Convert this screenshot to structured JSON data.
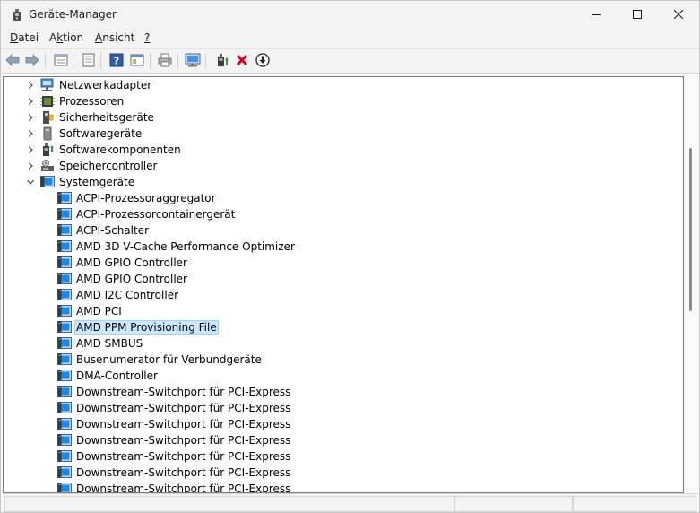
{
  "window": {
    "title": "Geräte-Manager",
    "app_icon": "device-manager-icon",
    "controls": [
      "minimize-icon",
      "maximize-icon",
      "close-icon"
    ]
  },
  "menu": [
    {
      "label": "Datei",
      "underline_index": 0
    },
    {
      "label": "Aktion",
      "underline_index": 1
    },
    {
      "label": "Ansicht",
      "underline_index": 0
    },
    {
      "label": "?",
      "underline_index": 0
    }
  ],
  "toolbar": [
    "back-arrow-icon",
    "forward-arrow-icon",
    "properties-list-icon",
    "properties-page-icon",
    "help-icon",
    "view-details-icon",
    "print-icon",
    "monitor-scan-icon",
    "update-driver-icon",
    "uninstall-device-icon",
    "disable-device-icon"
  ],
  "tree": {
    "categories": [
      {
        "label": "Netzwerkadapter",
        "icon": "network-adapter-icon",
        "expanded": false
      },
      {
        "label": "Prozessoren",
        "icon": "processor-icon",
        "expanded": false
      },
      {
        "label": "Sicherheitsgeräte",
        "icon": "security-device-icon",
        "expanded": false
      },
      {
        "label": "Softwaregeräte",
        "icon": "software-device-icon",
        "expanded": false
      },
      {
        "label": "Softwarekomponenten",
        "icon": "software-component-icon",
        "expanded": false
      },
      {
        "label": "Speichercontroller",
        "icon": "storage-controller-icon",
        "expanded": false
      },
      {
        "label": "Systemgeräte",
        "icon": "system-device-icon",
        "expanded": true
      }
    ],
    "system_devices": [
      "ACPI-Prozessoraggregator",
      "ACPI-Prozessorcontainergerät",
      "ACPI-Schalter",
      "AMD 3D V-Cache Performance Optimizer",
      "AMD GPIO Controller",
      "AMD GPIO Controller",
      "AMD I2C Controller",
      "AMD PCI",
      "AMD PPM Provisioning File",
      "AMD SMBUS",
      "Busenumerator für Verbundgeräte",
      "DMA-Controller",
      "Downstream-Switchport für PCI-Express",
      "Downstream-Switchport für PCI-Express",
      "Downstream-Switchport für PCI-Express",
      "Downstream-Switchport für PCI-Express",
      "Downstream-Switchport für PCI-Express",
      "Downstream-Switchport für PCI-Express",
      "Downstream-Switchport für PCI-Express"
    ],
    "selected_device": "AMD PPM Provisioning File"
  },
  "colors": {
    "selection_bg": "#cce8ff",
    "selection_border": "#99d1ff",
    "accent_blue": "#0a6fc2"
  }
}
